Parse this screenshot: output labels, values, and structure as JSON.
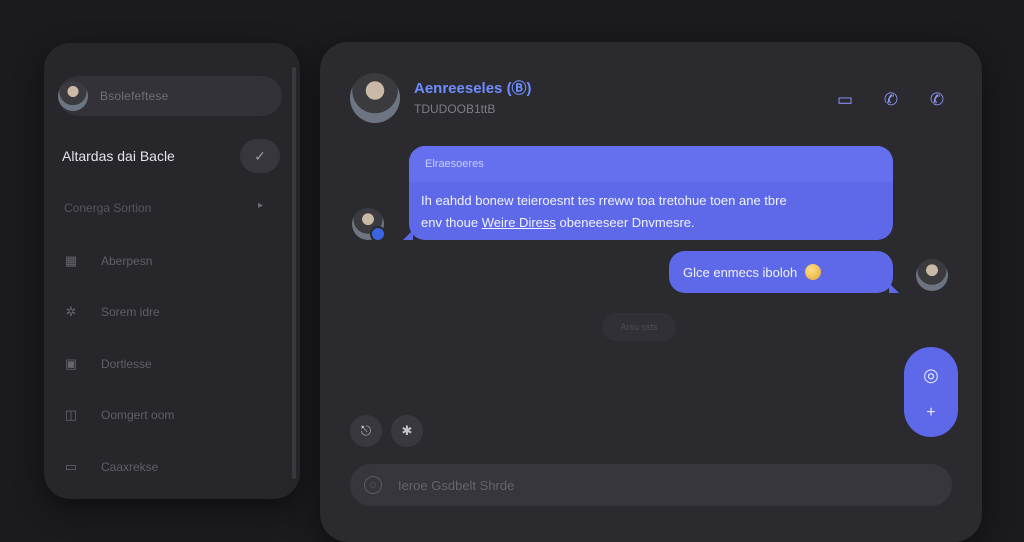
{
  "sidebar": {
    "profile_name": "Bsolefeftese",
    "heading": "Altardas dai Bacle",
    "heading_button_icon": "✓",
    "section_label": "Conerga Sortion",
    "section_chevron": "▸",
    "items": [
      {
        "icon": "grid-icon",
        "glyph": "▦",
        "label": "Aberpesn"
      },
      {
        "icon": "star-icon",
        "glyph": "✲",
        "label": "Sorem idre"
      },
      {
        "icon": "image-icon",
        "glyph": "▣",
        "label": "Dortlesse"
      },
      {
        "icon": "calendar-icon",
        "glyph": "◫",
        "label": "Oomgert oom"
      },
      {
        "icon": "layout-icon",
        "glyph": "▭",
        "label": "Caaxrekse"
      }
    ]
  },
  "chat": {
    "contact_name": "Aenreeseles (Ⓑ)",
    "contact_status": "TDUDOOB1ttB",
    "header_icons": [
      {
        "name": "video-call-icon",
        "glyph": "▭"
      },
      {
        "name": "phone-icon",
        "glyph": "✆"
      },
      {
        "name": "call-icon",
        "glyph": "✆"
      }
    ],
    "incoming": {
      "quote": "Elraesoeres",
      "line1": "Ih eahdd bonew teieroesnt tes rreww toa tretohue toen ane tbre",
      "line2_prefix": "env thoue",
      "link": "Weire Diress",
      "line2_suffix": " obeneeseer Dnvmesre."
    },
    "outgoing": {
      "text": "Glce enmecs iboloh"
    },
    "date_chip": "Arsu ssts",
    "fab": {
      "top_icon": "◎",
      "bottom_icon": "+"
    },
    "attach_icon": "⎋",
    "sticker_icon": "✱",
    "composer": {
      "icon": "☺",
      "placeholder": "Ieroe Gsdbelt Shrde"
    }
  }
}
